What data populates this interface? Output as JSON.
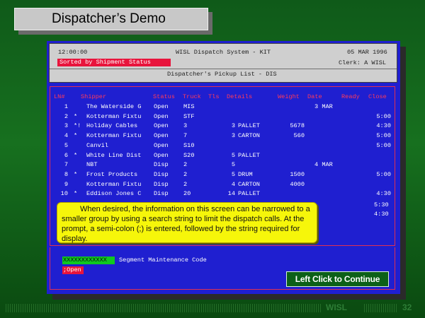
{
  "slide": {
    "title": "Dispatcher’s Demo",
    "continue_label": "Left Click to Continue",
    "footer_brand": "WISL",
    "footer_page": "32"
  },
  "header": {
    "time": "12:00:00",
    "system_title": "WISL Dispatch System - KIT",
    "date": "05 MAR 1996",
    "sorted_label": "Sorted by Shipment Status",
    "clerk": "Clerk: A WISL",
    "list_title": "Dispatcher's Pickup List - DIS"
  },
  "columns": {
    "ln": "LN#",
    "shipper": "Shipper",
    "status": "Status",
    "truck": "Truck",
    "tls": "Tls",
    "details": "Details",
    "weight": "Weight",
    "date": "Date",
    "ready": "Ready",
    "close": "Close"
  },
  "rows": [
    {
      "ln": "1",
      "flag": "",
      "shipper": "The Waterside G",
      "status": "Open",
      "truck": "MIS",
      "tls": "",
      "details": "",
      "weight": "",
      "date": "3 MAR",
      "ready": ""
    },
    {
      "ln": "2",
      "flag": "*",
      "shipper": "Kotterman Fixtu",
      "status": "Open",
      "truck": "STF",
      "tls": "",
      "details": "",
      "weight": "",
      "date": "",
      "ready": "5:00"
    },
    {
      "ln": "3",
      "flag": "*!",
      "shipper": "Holiday Cables",
      "status": "Open",
      "truck": "3",
      "tls": "3",
      "details": "PALLET",
      "weight": "5678",
      "date": "",
      "ready": "4:30"
    },
    {
      "ln": "4",
      "flag": "*",
      "shipper": "Kotterman Fixtu",
      "status": "Open",
      "truck": "7",
      "tls": "3",
      "details": "CARTON",
      "weight": "560",
      "date": "",
      "ready": "5:00"
    },
    {
      "ln": "5",
      "flag": "",
      "shipper": "Canvil",
      "status": "Open",
      "truck": "S10",
      "tls": "",
      "details": "",
      "weight": "",
      "date": "",
      "ready": "5:00"
    },
    {
      "ln": "6",
      "flag": "*",
      "shipper": "White Line Dist",
      "status": "Open",
      "truck": "S20",
      "tls": "5",
      "details": "PALLET",
      "weight": "",
      "date": "",
      "ready": ""
    },
    {
      "ln": "7",
      "flag": "",
      "shipper": "NBT",
      "status": "Disp",
      "truck": "2",
      "tls": "5",
      "details": "",
      "weight": "",
      "date": "4 MAR",
      "ready": ""
    },
    {
      "ln": "8",
      "flag": "*",
      "shipper": "Frost Products",
      "status": "Disp",
      "truck": "2",
      "tls": "5",
      "details": "DRUM",
      "weight": "1500",
      "date": "",
      "ready": "5:00"
    },
    {
      "ln": "9",
      "flag": "",
      "shipper": "Kotterman Fixtu",
      "status": "Disp",
      "truck": "2",
      "tls": "4",
      "details": "CARTON",
      "weight": "4000",
      "date": "",
      "ready": ""
    },
    {
      "ln": "10",
      "flag": "*",
      "shipper": "Eddison Jones C",
      "status": "Disp",
      "truck": "20",
      "tls": "14",
      "details": "PALLET",
      "weight": "",
      "date": "",
      "ready": "4:30"
    }
  ],
  "extra_ready": [
    "5:30",
    "4:30"
  ],
  "tooltip": {
    "text": "When desired, the information on this screen can be narrowed to a smaller group by using a search string to limit the dispatch calls. At the prompt, a semi-colon (;) is entered, followed by the string required for display."
  },
  "segment": {
    "input_value": "XXXXXXXXXXXX",
    "label": "Segment Maintenance Code",
    "prompt": ";Open"
  },
  "colors": {
    "background": "#17701f",
    "terminal_blue": "#1f1fd0",
    "header_gray": "#cfcfcf",
    "accent_red": "#e8143c",
    "tooltip_yellow": "#f6f60a",
    "input_green": "#10c820",
    "button_green": "#0c6018"
  }
}
